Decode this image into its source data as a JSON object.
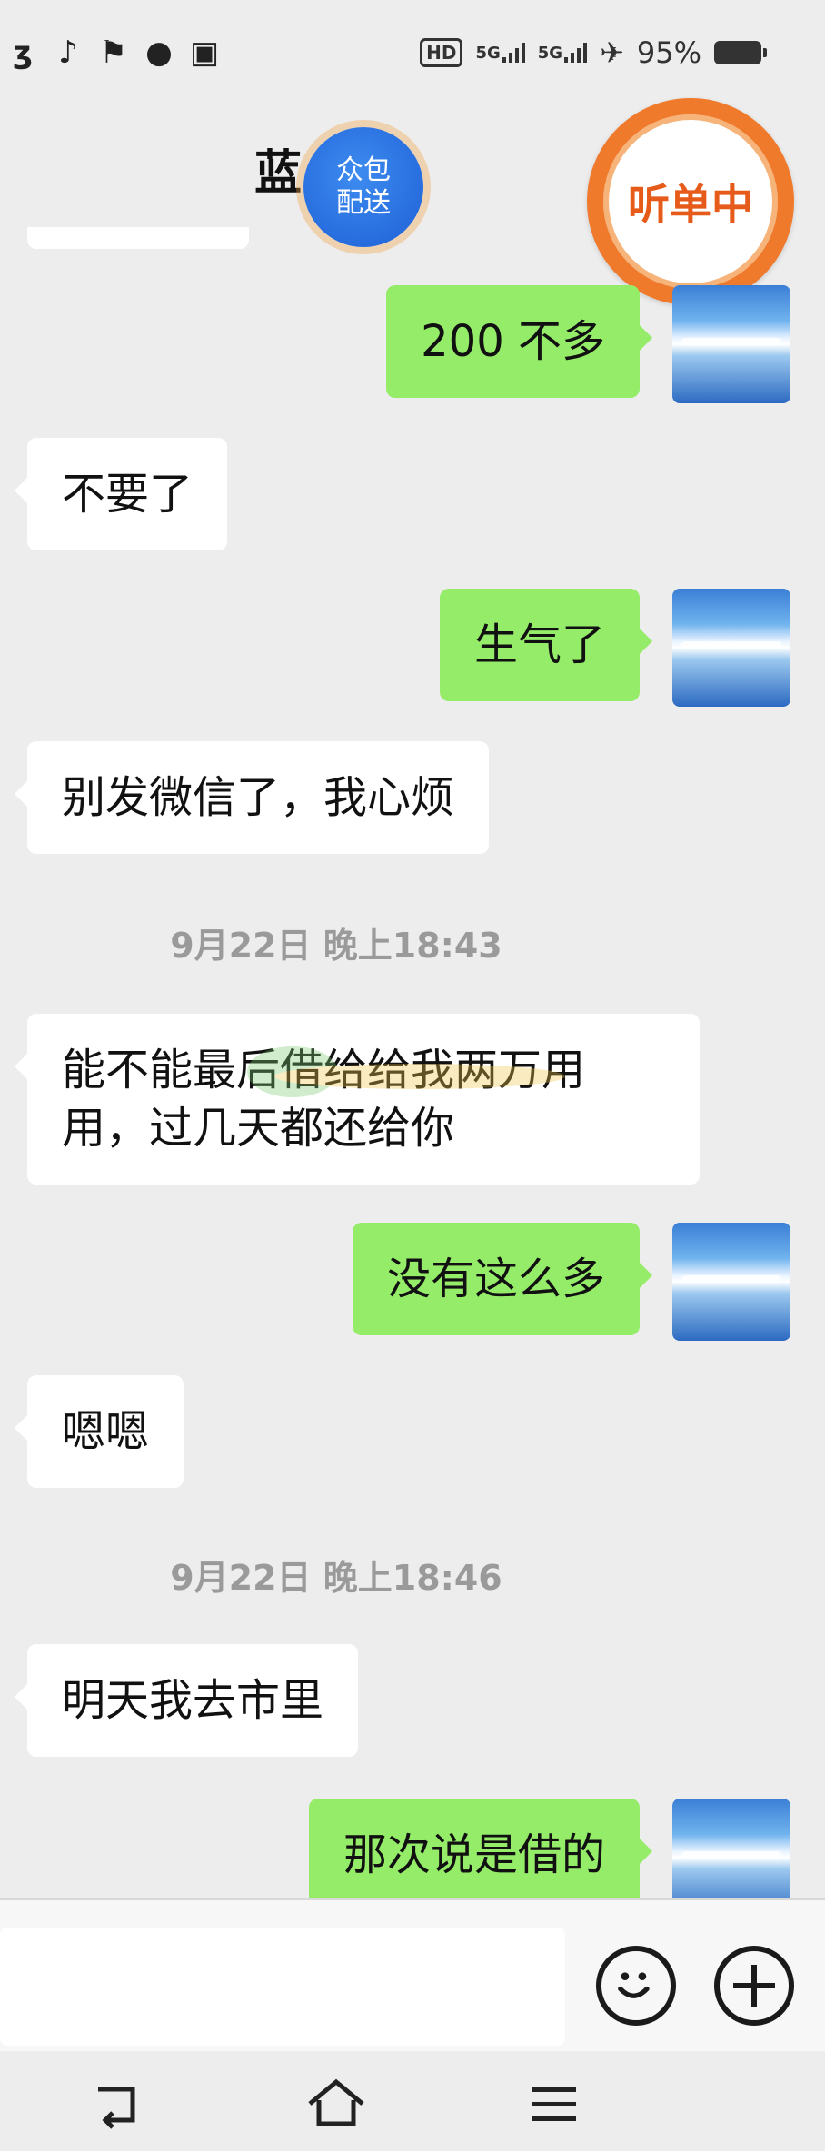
{
  "status_bar": {
    "left_icons": [
      "carrier-icon",
      "tiktok-icon",
      "app-icon",
      "chat-bubble-icon",
      "photo-icon"
    ],
    "hd_label": "HD",
    "network_1": "5G",
    "network_2": "5G",
    "battery": "95%"
  },
  "header": {
    "title": "蓝",
    "badge_blue": {
      "line1": "众包",
      "line2": "配送"
    },
    "badge_orange": "听单中"
  },
  "messages": [
    {
      "side": "out",
      "text": "200 不多"
    },
    {
      "side": "in",
      "text": "不要了"
    },
    {
      "side": "out",
      "text": "生气了"
    },
    {
      "side": "in",
      "text": "别发微信了，我心烦"
    },
    {
      "side": "time",
      "text": "9月22日 晚上18:43"
    },
    {
      "side": "in",
      "text": "能不能最后借给给我两万用\n用，过几天都还给你"
    },
    {
      "side": "out",
      "text": "没有这么多"
    },
    {
      "side": "in",
      "text": "嗯嗯"
    },
    {
      "side": "time",
      "text": "9月22日 晚上18:46"
    },
    {
      "side": "in",
      "text": "明天我去市里"
    },
    {
      "side": "out",
      "text": "那次说是借的"
    }
  ],
  "input_bar": {
    "value": ""
  },
  "colors": {
    "outgoing": "#95ec69",
    "incoming": "#ffffff",
    "background": "#ededed",
    "badge_orange": "#f07a2c",
    "badge_blue": "#2a73e4"
  }
}
